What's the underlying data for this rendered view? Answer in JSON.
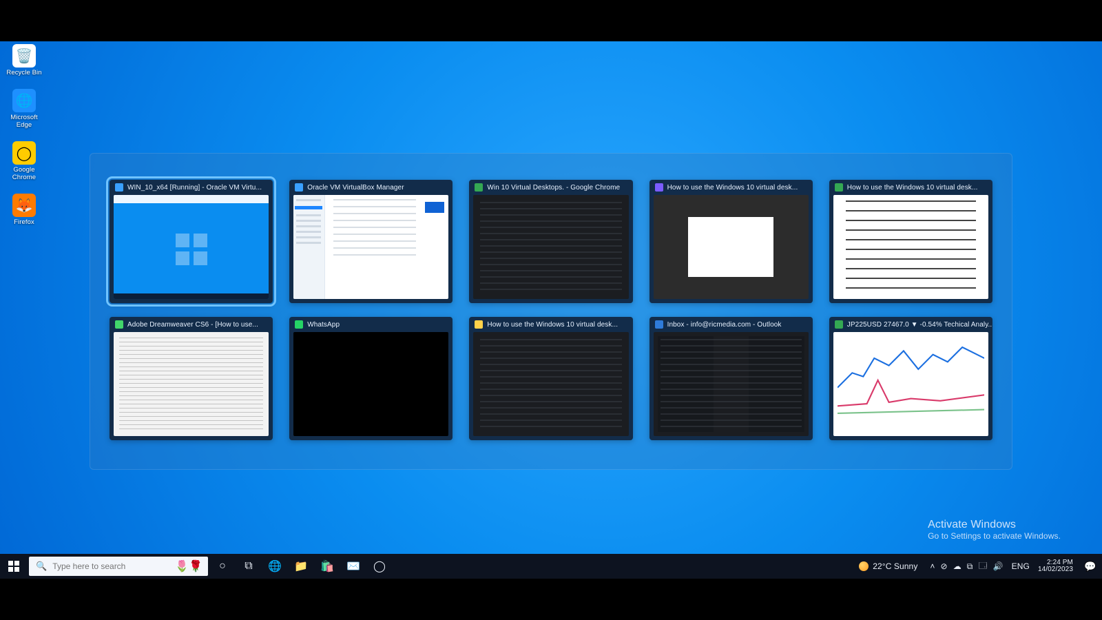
{
  "desktop_icons": [
    {
      "name": "recycle-bin",
      "label": "Recycle Bin",
      "glyph": "🗑️",
      "bg": "#ffffff"
    },
    {
      "name": "microsoft-edge",
      "label": "Microsoft Edge",
      "glyph": "🌐",
      "bg": "#1e90ff"
    },
    {
      "name": "google-chrome",
      "label": "Google Chrome",
      "glyph": "◯",
      "bg": "#ffcc00"
    },
    {
      "name": "firefox",
      "label": "Firefox",
      "glyph": "🦊",
      "bg": "#ff7b00"
    }
  ],
  "switcher": [
    {
      "title": "WIN_10_x64 [Running] - Oracle VM Virtu...",
      "icon_color": "#3aa0ff",
      "selected": true
    },
    {
      "title": "Oracle VM VirtualBox Manager",
      "icon_color": "#3aa0ff",
      "selected": false
    },
    {
      "title": "Win 10 Virtual Desktops. - Google Chrome",
      "icon_color": "#34a853",
      "selected": false
    },
    {
      "title": "How to use the Windows 10 virtual desk...",
      "icon_color": "#7b5cff",
      "selected": false
    },
    {
      "title": "How to use the Windows 10 virtual desk...",
      "icon_color": "#34a853",
      "selected": false
    },
    {
      "title": "Adobe Dreamweaver CS6 - [How to use...",
      "icon_color": "#42d66b",
      "selected": false
    },
    {
      "title": "WhatsApp",
      "icon_color": "#25d366",
      "selected": false
    },
    {
      "title": "How to use the Windows 10 virtual desk...",
      "icon_color": "#ffd24a",
      "selected": false
    },
    {
      "title": "Inbox - info@ricmedia.com - Outlook",
      "icon_color": "#2f7bd9",
      "selected": false
    },
    {
      "title": "JP225USD 27467.0 ▼ -0.54% Techical Analy...",
      "icon_color": "#34a853",
      "selected": false
    }
  ],
  "watermark": {
    "line1": "Activate Windows",
    "line2": "Go to Settings to activate Windows."
  },
  "taskbar": {
    "search_placeholder": "Type here to search",
    "weather_text": "22°C  Sunny",
    "lang": "ENG",
    "time": "2:24 PM",
    "date": "14/02/2023",
    "tray_glyphs": [
      "˄",
      "⊘",
      "☁",
      "⧉",
      "🗔",
      "🔊"
    ]
  }
}
